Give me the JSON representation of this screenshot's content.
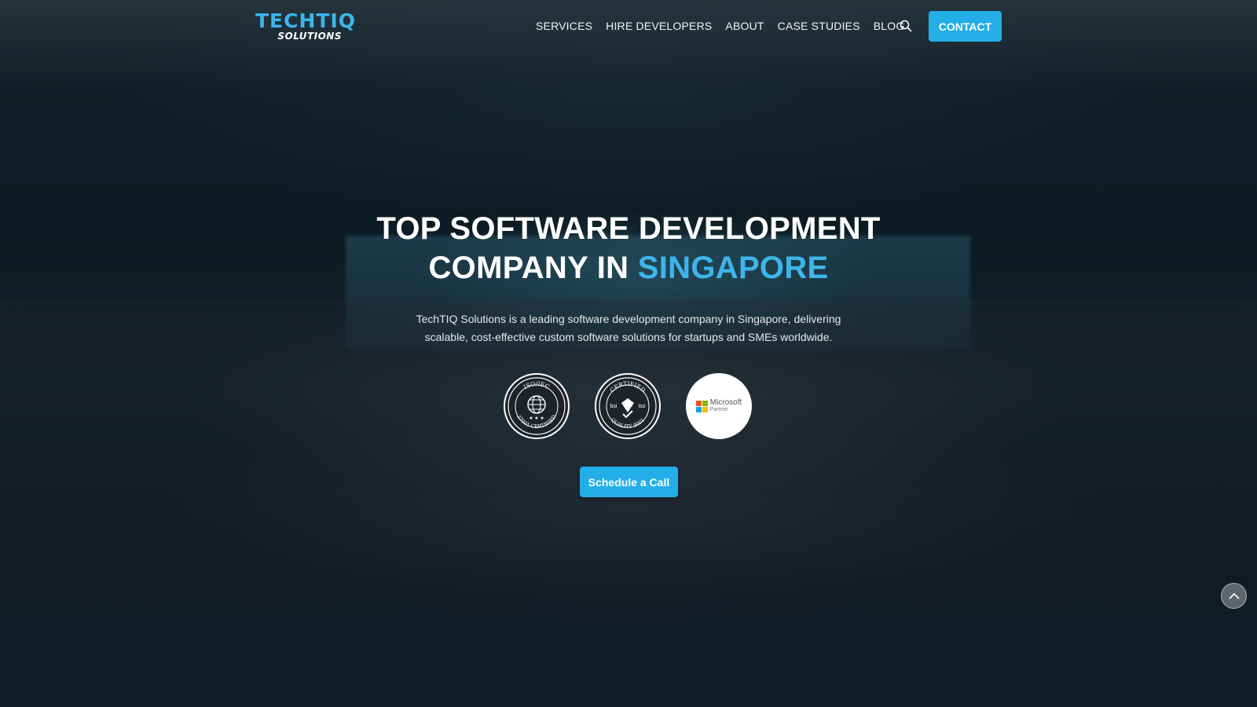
{
  "header": {
    "logo": {
      "main": "TECHTIQ",
      "sub": "SOLUTIONS"
    },
    "nav": [
      {
        "label": "SERVICES"
      },
      {
        "label": "HIRE DEVELOPERS"
      },
      {
        "label": "ABOUT"
      },
      {
        "label": "CASE STUDIES"
      },
      {
        "label": "BLOG"
      }
    ],
    "search_icon": "search-icon",
    "contact_label": "CONTACT"
  },
  "hero": {
    "title_line1": "TOP SOFTWARE DEVELOPMENT",
    "title_line2_prefix": "COMPANY IN ",
    "title_line2_accent": "SINGAPORE",
    "subtitle_line1": "TechTIQ Solutions is a leading software development company in Singapore, delivering",
    "subtitle_line2": "scalable, cost-effective custom software solutions for startups and SMEs worldwide.",
    "badges": {
      "iso27001": {
        "top": "ISO/IEC",
        "bottom": "27001 CERTIFIED"
      },
      "iso9001": {
        "top": "CERTIFIED",
        "left": "bsi",
        "right": "iso",
        "bottom": "QUALITY 9001"
      },
      "microsoft": {
        "name": "Microsoft",
        "sub": "Partner"
      }
    },
    "cta_label": "Schedule a Call"
  },
  "scroll_top_icon": "chevron-up-icon",
  "colors": {
    "accent": "#3eb5ea",
    "button": "#24aee8",
    "text": "#ffffff",
    "ms_red": "#f25022",
    "ms_green": "#7fba00",
    "ms_blue": "#00a4ef",
    "ms_yellow": "#ffb900"
  }
}
